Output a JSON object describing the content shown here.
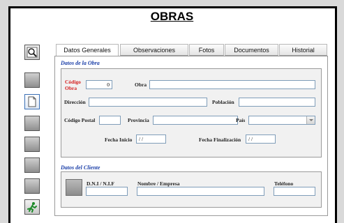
{
  "window": {
    "title": "OBRAS"
  },
  "toolbar": {
    "buttons": [
      {
        "name": "search-button",
        "icon": "magnifier-icon"
      },
      {
        "name": "toolbar-button-2",
        "icon": "blank-icon"
      },
      {
        "name": "new-document-button",
        "icon": "document-icon"
      },
      {
        "name": "toolbar-button-4",
        "icon": "blank-icon"
      },
      {
        "name": "toolbar-button-5",
        "icon": "blank-icon"
      },
      {
        "name": "toolbar-button-6",
        "icon": "blank-icon"
      },
      {
        "name": "toolbar-button-7",
        "icon": "blank-icon"
      },
      {
        "name": "exit-button",
        "icon": "running-man-icon"
      }
    ]
  },
  "tabs": [
    {
      "label": "Datos Generales",
      "selected": true
    },
    {
      "label": "Observaciones",
      "selected": false
    },
    {
      "label": "Fotos",
      "selected": false
    },
    {
      "label": "Documentos",
      "selected": false
    },
    {
      "label": "Historial",
      "selected": false
    }
  ],
  "obra_section": {
    "title": "Datos de la Obra",
    "codigo_label": "Código Obra",
    "codigo_value": "0",
    "obra_label": "Obra",
    "obra_value": "",
    "direccion_label": "Dirección",
    "direccion_value": "",
    "poblacion_label": "Población",
    "poblacion_value": "",
    "cp_label": "Código Postal",
    "cp_value": "",
    "provincia_label": "Provincia",
    "provincia_value": "",
    "pais_label": "País",
    "pais_value": "",
    "fecha_inicio_label": "Fecha Inicio",
    "fecha_inicio_value": " / /",
    "fecha_fin_label": "Fecha Finalización",
    "fecha_fin_value": " / /"
  },
  "cliente_section": {
    "title": "Datos del Cliente",
    "dni_label": "D.N.I / N.I.F",
    "dni_value": "",
    "empresa_label": "Nombre / Empresa",
    "empresa_value": "",
    "telefono_label": "Teléfono",
    "telefono_value": ""
  },
  "colors": {
    "section_title": "#1b3fa8",
    "required_label": "#d41f1f",
    "field_border": "#7f9db9"
  }
}
